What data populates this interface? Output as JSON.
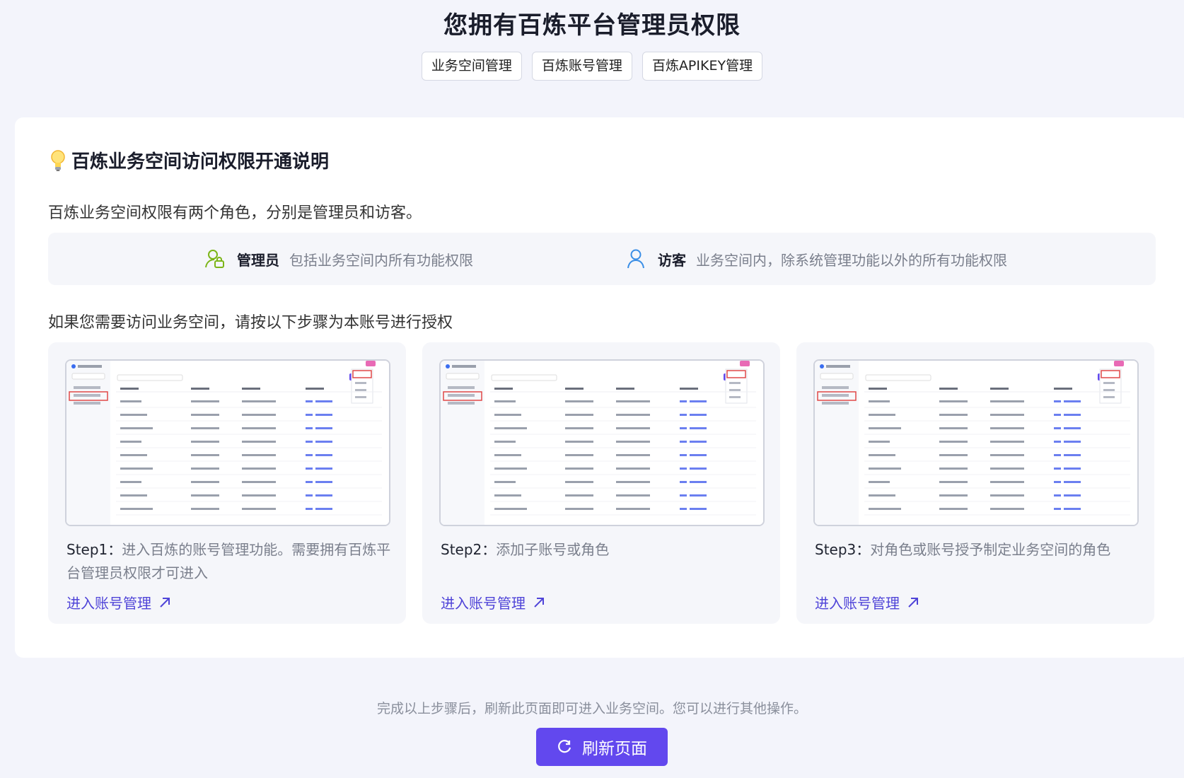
{
  "header": {
    "title": "您拥有百炼平台管理员权限",
    "tabs": [
      "业务空间管理",
      "百炼账号管理",
      "百炼APIKEY管理"
    ]
  },
  "card": {
    "title": "百炼业务空间访问权限开通说明",
    "roles_intro": "百炼业务空间权限有两个角色，分别是管理员和访客。",
    "roles": [
      {
        "name": "管理员",
        "desc": "包括业务空间内所有功能权限",
        "icon": "admin-user-icon",
        "color": "#7cb518"
      },
      {
        "name": "访客",
        "desc": "业务空间内，除系统管理功能以外的所有功能权限",
        "icon": "guest-user-icon",
        "color": "#3a8ee6"
      }
    ],
    "steps_intro": "如果您需要访问业务空间，请按以下步骤为本账号进行授权",
    "steps": [
      {
        "label": "Step1：",
        "text": "进入百炼的账号管理功能。需要拥有百炼平台管理员权限才可进入",
        "link": "进入账号管理"
      },
      {
        "label": "Step2：",
        "text": "添加子账号或角色",
        "link": "进入账号管理"
      },
      {
        "label": "Step3：",
        "text": "对角色或账号授予制定业务空间的角色",
        "link": "进入账号管理"
      }
    ]
  },
  "footer": {
    "note": "完成以上步骤后，刷新此页面即可进入业务空间。您可以进行其他操作。",
    "refresh_label": "刷新页面"
  },
  "colors": {
    "accent": "#6248ee",
    "link": "#4f44d8",
    "background": "#f3f4fb"
  }
}
